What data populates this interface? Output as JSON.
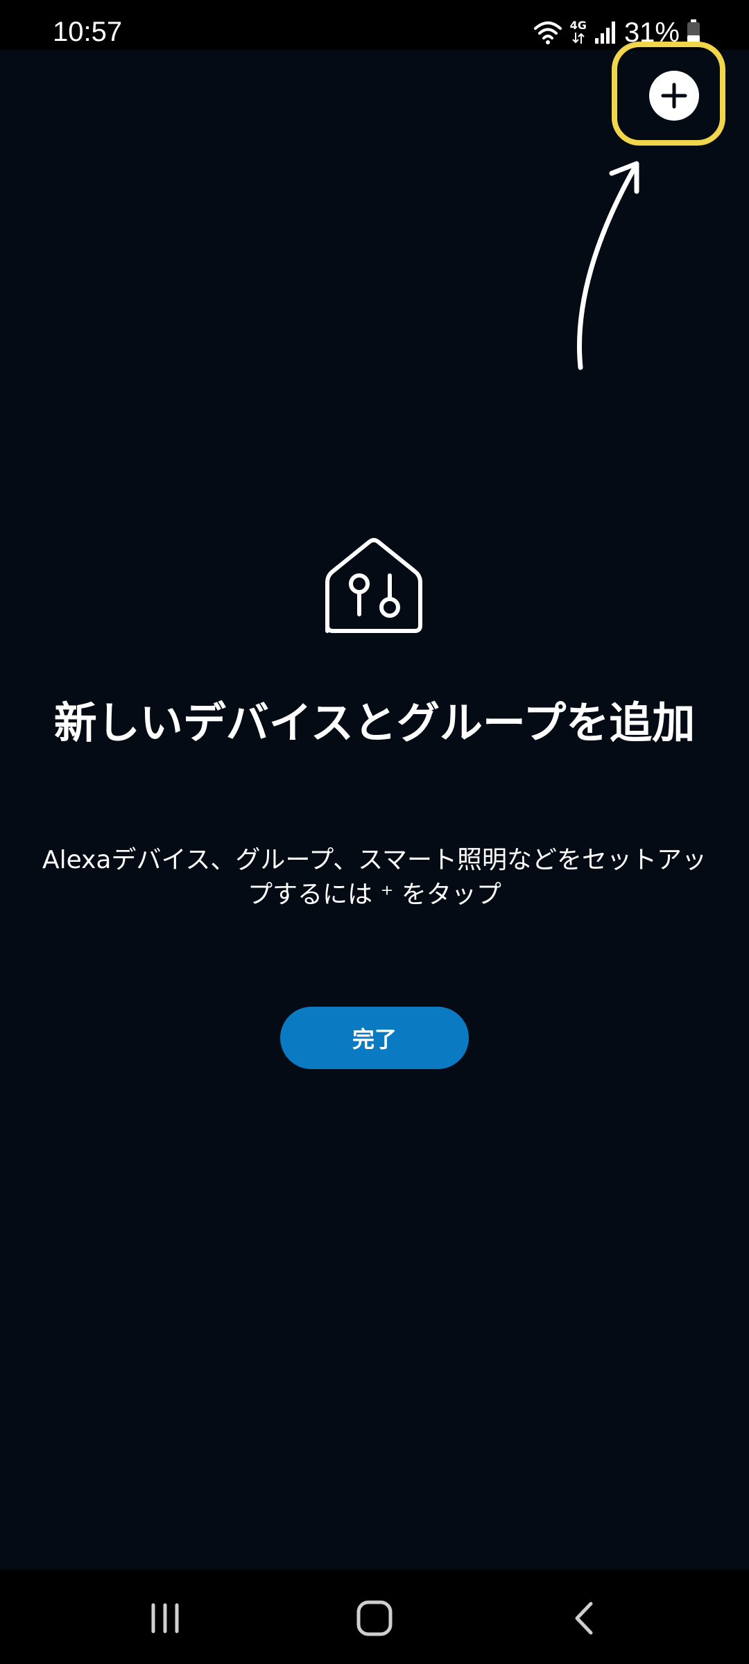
{
  "status_bar": {
    "time": "10:57",
    "network": "4G",
    "battery": "31%"
  },
  "header": {
    "add_icon": "plus-circle-icon"
  },
  "main": {
    "icon": "smart-home-icon",
    "title": "新しいデバイスとグループを追加",
    "subtitle": "Alexaデバイス、グループ、スマート照明などをセットアップするには ⁺ をタップ",
    "done_label": "完了"
  },
  "nav": {
    "recents": "recents-icon",
    "home": "home-icon",
    "back": "back-icon"
  },
  "colors": {
    "background": "#040b14",
    "accent": "#0a7bc2",
    "highlight": "#f1d54a"
  }
}
